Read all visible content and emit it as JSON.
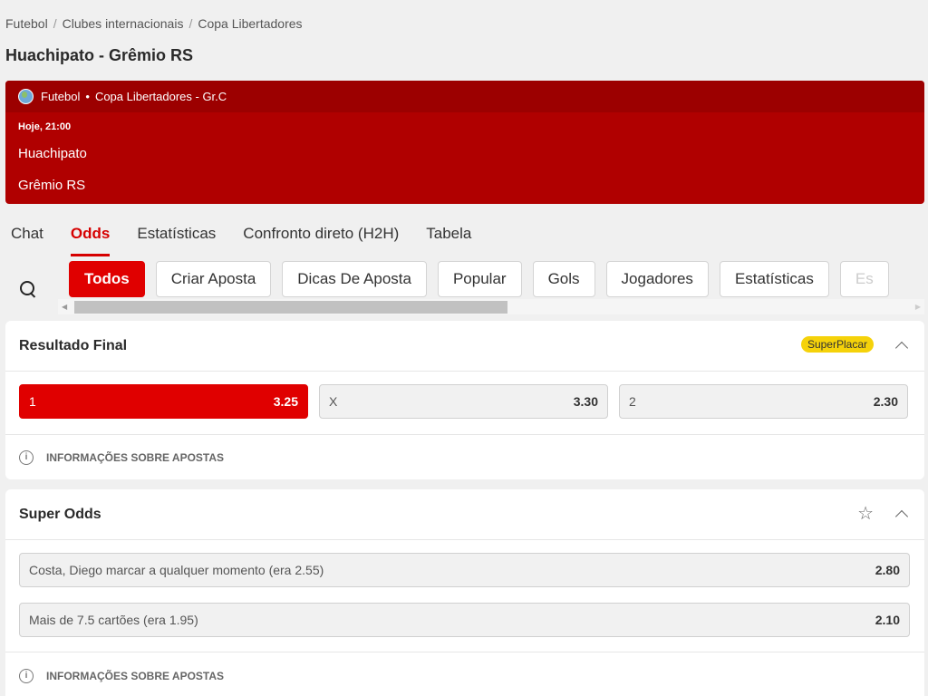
{
  "breadcrumb": [
    "Futebol",
    "Clubes internacionais",
    "Copa Libertadores"
  ],
  "page_title": "Huachipato - Grêmio RS",
  "event": {
    "sport": "Futebol",
    "competition": "Copa Libertadores - Gr.C",
    "time": "Hoje, 21:00",
    "home_team": "Huachipato",
    "away_team": "Grêmio RS"
  },
  "main_tabs": [
    {
      "label": "Chat",
      "active": false
    },
    {
      "label": "Odds",
      "active": true
    },
    {
      "label": "Estatísticas",
      "active": false
    },
    {
      "label": "Confronto direto (H2H)",
      "active": false
    },
    {
      "label": "Tabela",
      "active": false
    }
  ],
  "filters": [
    {
      "label": "Todos",
      "active": true
    },
    {
      "label": "Criar Aposta"
    },
    {
      "label": "Dicas De Aposta"
    },
    {
      "label": "Popular"
    },
    {
      "label": "Gols"
    },
    {
      "label": "Jogadores"
    },
    {
      "label": "Estatísticas"
    },
    {
      "label": "Es"
    }
  ],
  "result_market": {
    "title": "Resultado Final",
    "badge": "SuperPlacar",
    "outcomes": [
      {
        "label": "1",
        "odd": "3.25",
        "selected": true
      },
      {
        "label": "X",
        "odd": "3.30",
        "selected": false
      },
      {
        "label": "2",
        "odd": "2.30",
        "selected": false
      }
    ],
    "info": "INFORMAÇÕES SOBRE APOSTAS"
  },
  "super_odds": {
    "title": "Super Odds",
    "items": [
      {
        "label": "Costa, Diego marcar a qualquer momento (era 2.55)",
        "odd": "2.80"
      },
      {
        "label": "Mais de 7.5 cartões (era 1.95)",
        "odd": "2.10"
      }
    ],
    "info": "INFORMAÇÕES SOBRE APOSTAS"
  },
  "colors": {
    "brand_red": "#e00000",
    "header_red": "#b00000",
    "badge_yellow": "#f5d20a"
  }
}
